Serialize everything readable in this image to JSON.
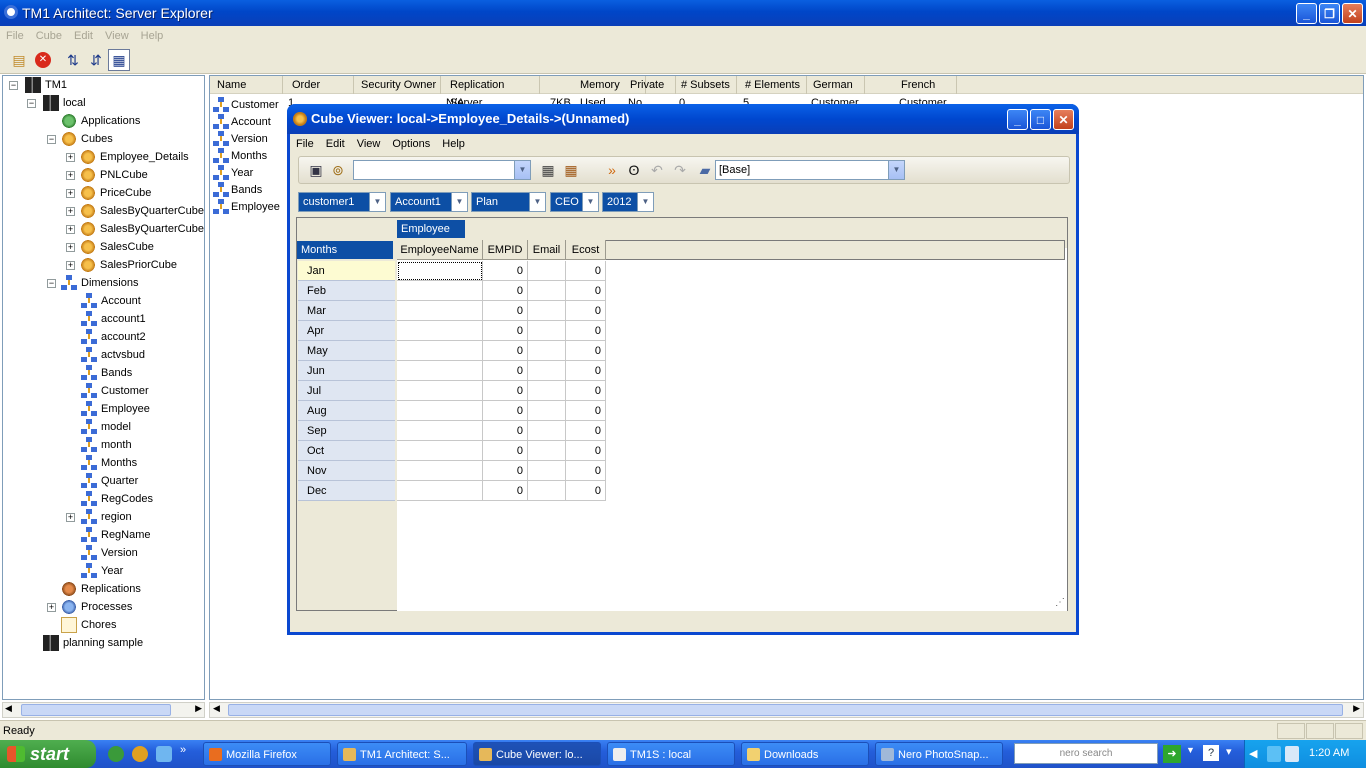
{
  "app": {
    "title": "TM1 Architect: Server Explorer"
  },
  "menu": [
    "File",
    "Cube",
    "Edit",
    "View",
    "Help"
  ],
  "tree": {
    "server": "TM1",
    "local": "local",
    "applications": "Applications",
    "cubes_label": "Cubes",
    "cubes": [
      "Employee_Details",
      "PNLCube",
      "PriceCube",
      "SalesByQuarterCube",
      "SalesByQuarterCube",
      "SalesCube",
      "SalesPriorCube"
    ],
    "dimensions_label": "Dimensions",
    "dimensions": [
      "Account",
      "account1",
      "account2",
      "actvsbud",
      "Bands",
      "Customer",
      "Employee",
      "model",
      "month",
      "Months",
      "Quarter",
      "RegCodes",
      "region",
      "RegName",
      "Version",
      "Year"
    ],
    "replications": "Replications",
    "processes": "Processes",
    "chores": "Chores",
    "planning": "planning sample"
  },
  "pane": {
    "columns": [
      "Name",
      "Order",
      "Security Owner",
      "Replication Server",
      "Memory Used",
      "Private",
      "# Subsets",
      "# Elements",
      "German",
      "French"
    ],
    "rows": [
      "Customer",
      "Account",
      "Version",
      "Months",
      "Year",
      "Bands",
      "Employee"
    ],
    "first_row_partial": {
      "order": "1",
      "security": "N/A",
      "memory": "7KB",
      "private": "No",
      "subsets": "0",
      "elements": "5",
      "german": "Customer",
      "french": "Customer"
    }
  },
  "status": {
    "text": "Ready"
  },
  "cube_viewer": {
    "title": "Cube Viewer: local->Employee_Details->(Unnamed)",
    "menu": [
      "File",
      "Edit",
      "View",
      "Options",
      "Help"
    ],
    "view_combo": "",
    "alias_combo": "[Base]",
    "title_dims": [
      "customer1",
      "Account1",
      "Plan",
      "CEO",
      "2012"
    ],
    "column_dim": "Employee",
    "row_dim": "Months",
    "columns": [
      "EmployeeName",
      "EMPID",
      "Email",
      "Ecost"
    ],
    "rows": [
      {
        "label": "Jan",
        "empid": "0",
        "ecost": "0"
      },
      {
        "label": "Feb",
        "empid": "0",
        "ecost": "0"
      },
      {
        "label": "Mar",
        "empid": "0",
        "ecost": "0"
      },
      {
        "label": "Apr",
        "empid": "0",
        "ecost": "0"
      },
      {
        "label": "May",
        "empid": "0",
        "ecost": "0"
      },
      {
        "label": "Jun",
        "empid": "0",
        "ecost": "0"
      },
      {
        "label": "Jul",
        "empid": "0",
        "ecost": "0"
      },
      {
        "label": "Aug",
        "empid": "0",
        "ecost": "0"
      },
      {
        "label": "Sep",
        "empid": "0",
        "ecost": "0"
      },
      {
        "label": "Oct",
        "empid": "0",
        "ecost": "0"
      },
      {
        "label": "Nov",
        "empid": "0",
        "ecost": "0"
      },
      {
        "label": "Dec",
        "empid": "0",
        "ecost": "0"
      }
    ]
  },
  "taskbar": {
    "start": "start",
    "tasks": [
      "Mozilla Firefox",
      "TM1 Architect: S...",
      "Cube Viewer: lo...",
      "TM1S : local",
      "Downloads",
      "Nero PhotoSnap..."
    ],
    "search": "nero search",
    "time": "1:20 AM"
  },
  "colors": {
    "xp_blue": "#0046c8",
    "dim_selector": "#0d4fa5",
    "start_green": "#2f8b2f"
  }
}
